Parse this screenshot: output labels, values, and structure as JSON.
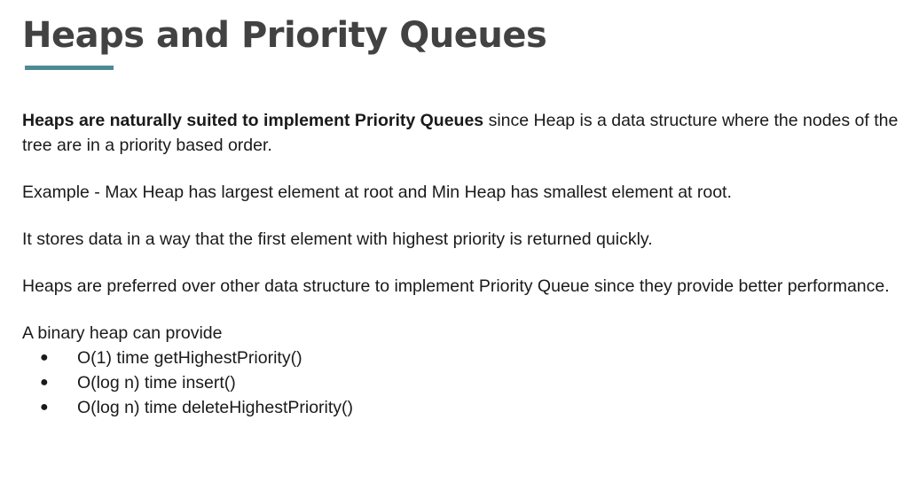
{
  "slide": {
    "title": "Heaps and Priority Queues",
    "accent_color": "#4e8a96",
    "paragraphs": [
      {
        "bold": "Heaps are naturally suited to implement Priority Queues",
        "text": " since Heap is a data structure where the nodes of the tree are in a priority based order."
      },
      {
        "text": "Example - Max Heap has largest element at root and Min Heap has smallest element at root."
      },
      {
        "text": "It stores data in a way that the first element with highest priority is returned quickly."
      },
      {
        "text": "Heaps are preferred over other data structure to implement Priority Queue since they provide better performance."
      }
    ],
    "list_intro": "A binary heap can provide",
    "bullet_glyph": "●",
    "bullets": [
      "O(1) time getHighestPriority()",
      "O(log n) time insert()",
      "O(log n) time deleteHighestPriority()"
    ]
  }
}
